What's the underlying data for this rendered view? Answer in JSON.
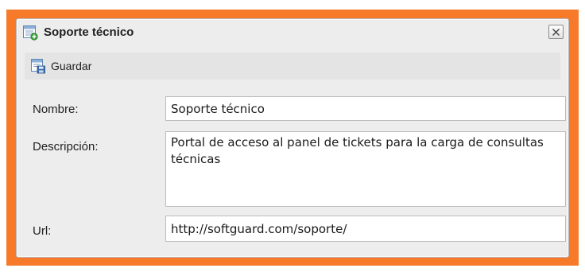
{
  "dialog": {
    "title": "Soporte técnico",
    "title_icon": "add-form-icon",
    "close_icon": "close-icon"
  },
  "toolbar": {
    "save_label": "Guardar",
    "save_icon": "save-form-icon"
  },
  "form": {
    "nombre_label": "Nombre:",
    "nombre_value": "Soporte técnico",
    "descripcion_label": "Descripción:",
    "descripcion_value": "Portal de acceso al panel de tickets para la carga de consultas técnicas",
    "url_label": "Url:",
    "url_value": "http://softguard.com/soporte/"
  },
  "colors": {
    "frame_accent": "#f67a2a",
    "dialog_background": "#ededed",
    "toolbar_background": "#e4e4e4"
  }
}
